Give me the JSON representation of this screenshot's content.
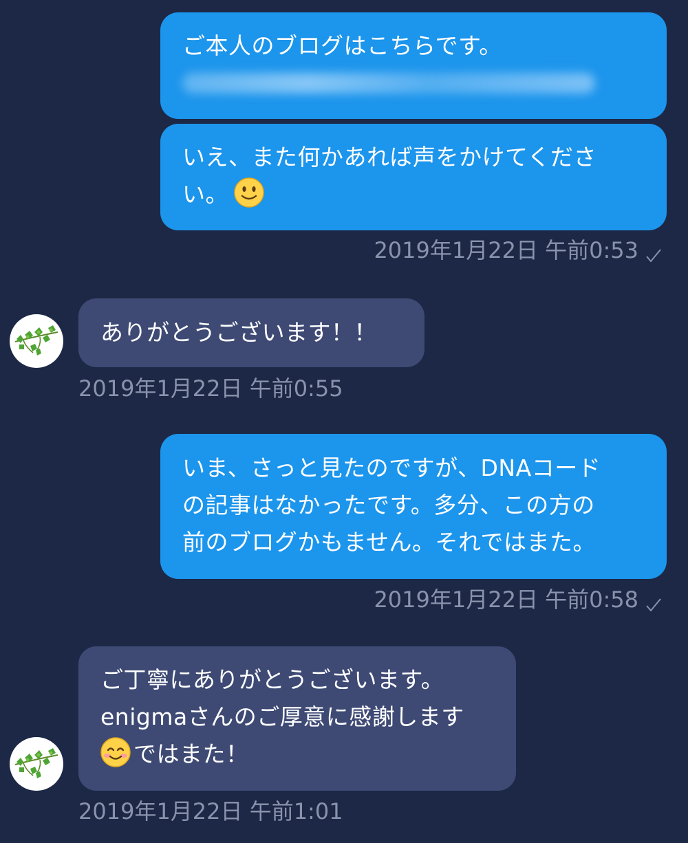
{
  "messages": [
    {
      "direction": "outgoing",
      "lines": [
        "ご本人のブログはこちらです。"
      ],
      "redacted_link": true
    },
    {
      "direction": "outgoing",
      "lines": [
        "いえ、また何かあれば声をかけてくださ",
        "い。"
      ],
      "emoji": "slightly-smiling-face-icon",
      "timestamp": "2019年1月22日 午前0:53",
      "read_check": true
    },
    {
      "direction": "incoming",
      "lines": [
        "ありがとうございます！！"
      ],
      "timestamp": "2019年1月22日 午前0:55"
    },
    {
      "direction": "outgoing",
      "lines": [
        "いま、さっと見たのですが、DNAコード",
        "の記事はなかったです。多分、この方の",
        "前のブログかもません。それではまた。"
      ],
      "timestamp": "2019年1月22日 午前0:58",
      "read_check": true
    },
    {
      "direction": "incoming",
      "lines": [
        "ご丁寧にありがとうございます。",
        "enigmaさんのご厚意に感謝します",
        "ではまた！"
      ],
      "emoji": "smiling-face-with-smiling-eyes-icon",
      "timestamp": "2019年1月22日 午前1:01"
    }
  ],
  "colors": {
    "background": "#1c2845",
    "outgoing_bubble": "#1c95ec",
    "incoming_bubble": "#3e4a74",
    "timestamp_text": "#8a93ad",
    "message_text": "#ffffff"
  }
}
